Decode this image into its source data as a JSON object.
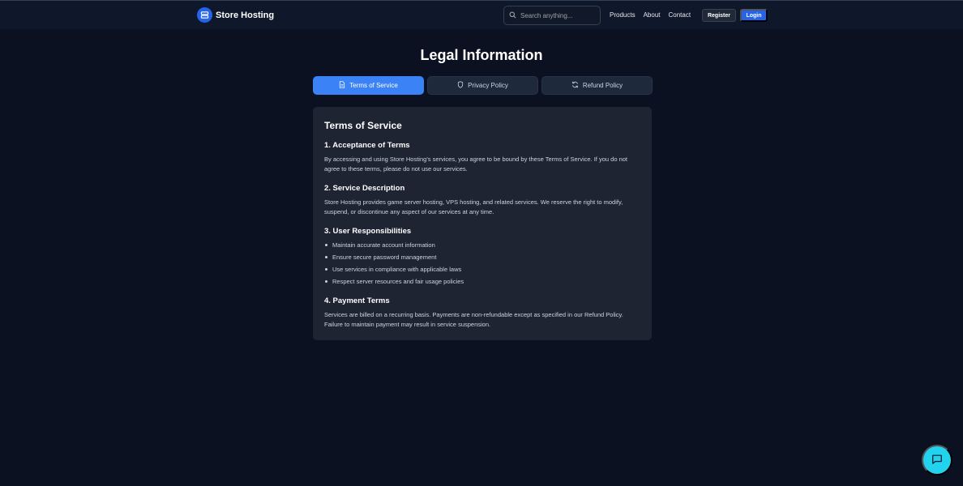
{
  "header": {
    "brand_name": "Store Hosting",
    "search_placeholder": "Search anything...",
    "nav": [
      "Products",
      "About",
      "Contact"
    ],
    "register_label": "Register",
    "login_label": "Login"
  },
  "page": {
    "title": "Legal Information",
    "tabs": [
      {
        "label": "Terms of Service",
        "icon": "document-icon",
        "active": true
      },
      {
        "label": "Privacy Policy",
        "icon": "shield-icon",
        "active": false
      },
      {
        "label": "Refund Policy",
        "icon": "refresh-icon",
        "active": false
      }
    ]
  },
  "content": {
    "heading": "Terms of Service",
    "sections": [
      {
        "title": "1. Acceptance of Terms",
        "body": "By accessing and using Store Hosting's services, you agree to be bound by these Terms of Service. If you do not agree to these terms, please do not use our services."
      },
      {
        "title": "2. Service Description",
        "body": "Store Hosting provides game server hosting, VPS hosting, and related services. We reserve the right to modify, suspend, or discontinue any aspect of our services at any time."
      },
      {
        "title": "3. User Responsibilities",
        "items": [
          "Maintain accurate account information",
          "Ensure secure password management",
          "Use services in compliance with applicable laws",
          "Respect server resources and fair usage policies"
        ]
      },
      {
        "title": "4. Payment Terms",
        "body": "Services are billed on a recurring basis. Payments are non-refundable except as specified in our Refund Policy. Failure to maintain payment may result in service suspension."
      }
    ]
  },
  "colors": {
    "background": "#0b1120",
    "accent": "#3b82f6",
    "card": "#1e2432",
    "chat_button": "#22d3ee"
  },
  "icons": {
    "brand": "server-logo-icon",
    "search": "search-icon",
    "chat": "chat-bubble-icon"
  }
}
